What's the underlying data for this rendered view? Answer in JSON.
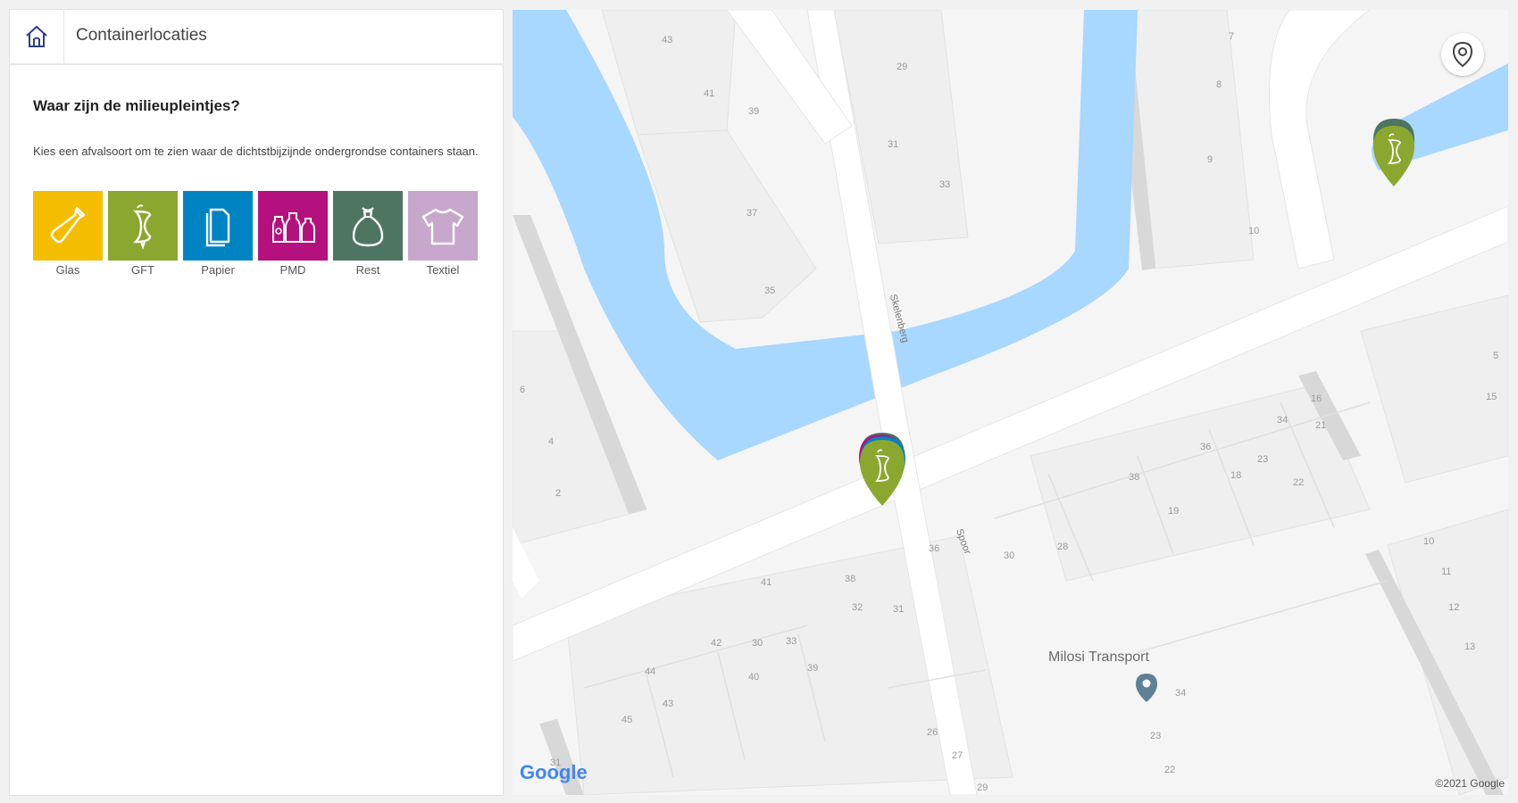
{
  "header": {
    "home_icon": "home-icon",
    "title": "Containerlocaties"
  },
  "intro": {
    "heading": "Waar zijn de milieupleintjes?",
    "description": "Kies een afvalsoort om te zien waar de dichtstbijzijnde ondergrondse containers staan."
  },
  "waste_types": [
    {
      "label": "Glas",
      "color": "#f5bd00",
      "icon": "bottle-icon"
    },
    {
      "label": "GFT",
      "color": "#8aa830",
      "icon": "apple-core-icon"
    },
    {
      "label": "Papier",
      "color": "#0083c3",
      "icon": "paper-icon"
    },
    {
      "label": "PMD",
      "color": "#b5117e",
      "icon": "bottles-icon"
    },
    {
      "label": "Rest",
      "color": "#4e7562",
      "icon": "trash-bag-icon"
    },
    {
      "label": "Textiel",
      "color": "#c8a7cc",
      "icon": "tshirt-icon"
    }
  ],
  "map": {
    "locate_icon": "location-pin-icon",
    "poi": {
      "label": "Milosi Transport",
      "icon": "place-pin-icon"
    },
    "street_labels": [
      "Skelenberg",
      "Spoor"
    ],
    "house_numbers": [
      "43",
      "41",
      "39",
      "37",
      "35",
      "29",
      "31",
      "33",
      "7",
      "8",
      "9",
      "10",
      "6",
      "4",
      "2",
      "34",
      "36",
      "38",
      "19",
      "18",
      "22",
      "23",
      "21",
      "16",
      "30",
      "28",
      "41",
      "38",
      "36",
      "32",
      "31",
      "42",
      "33",
      "30",
      "44",
      "40",
      "43",
      "39",
      "45",
      "26",
      "27",
      "29",
      "34",
      "23",
      "22",
      "10",
      "11",
      "12",
      "13",
      "15",
      "5",
      "31"
    ],
    "watermark": "Google",
    "copyright": "©2021 Google"
  }
}
